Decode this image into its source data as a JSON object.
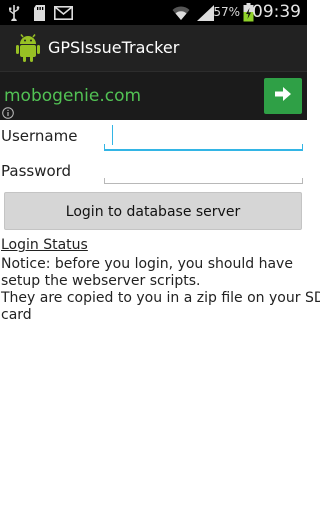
{
  "status_bar": {
    "icons": [
      "usb-icon",
      "sd-card-icon",
      "mail-icon",
      "wifi-icon",
      "signal-icon",
      "battery-icon"
    ],
    "battery_percent": "57%",
    "time": "09:39"
  },
  "action_bar": {
    "app_icon": "android-app-icon",
    "title": "GPSIssueTracker"
  },
  "ad_banner": {
    "text": "mobogenie.com",
    "arrow_icon": "arrow-right-icon",
    "info_icon": "info-icon",
    "accent_color": "#2fa046"
  },
  "form": {
    "username_label": "Username",
    "username_value": "",
    "password_label": "Password",
    "password_value": "",
    "login_button_label": "Login to database server",
    "focus_color": "#33b5e5"
  },
  "status_section": {
    "heading": "Login Status",
    "notice_lines": [
      "Notice: before you login, you should have",
      "setup the webserver scripts.",
      "They are copied to you in a zip file on your SD",
      "card"
    ]
  }
}
